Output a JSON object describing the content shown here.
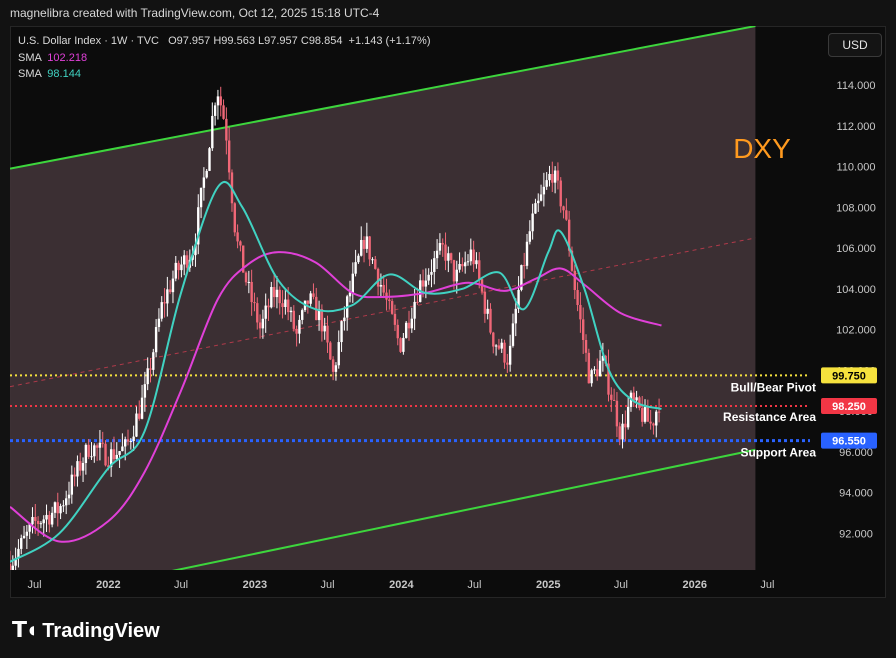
{
  "header": "magnelibra created with TradingView.com, Oct 12, 2025 15:18 UTC-4",
  "legend": {
    "symbol": "U.S. Dollar Index · 1W · TVC",
    "o_label": "O",
    "o": "97.957",
    "h_label": "H",
    "h": "99.563",
    "l_label": "L",
    "l": "97.957",
    "c_label": "C",
    "c": "98.854",
    "change": "+1.143 (+1.17%)",
    "sma1_label": "SMA",
    "sma1_value": "102.218",
    "sma2_label": "SMA",
    "sma2_value": "98.144"
  },
  "currency_button": "USD",
  "footer_brand": "TradingView",
  "colors": {
    "channel": "#3dd63d",
    "channel_fill": "#3e3236",
    "candle_up": "#ffffff",
    "candle_down": "#f06777",
    "sma_fast": "#40d2c2",
    "sma_slow": "#e040d8",
    "pivot": "#f6e23d",
    "resistance": "#f23645",
    "support": "#2962ff",
    "dxy_label": "#ff9a1f"
  },
  "chart_data": {
    "type": "candlestick",
    "title": "DXY",
    "y_axis": {
      "range": [
        90.2,
        116.9
      ],
      "ticks": [
        "92.000",
        "94.000",
        "96.000",
        "98.000",
        "100.000",
        "102.000",
        "104.000",
        "106.000",
        "108.000",
        "110.000",
        "112.000",
        "114.000"
      ]
    },
    "x_axis": {
      "range": [
        "2021-05-01",
        "2026-10-15"
      ],
      "ticks": [
        {
          "date": "2021-07-01",
          "label": "Jul"
        },
        {
          "date": "2022-01-01",
          "label": "2022"
        },
        {
          "date": "2022-07-01",
          "label": "Jul"
        },
        {
          "date": "2023-01-01",
          "label": "2023"
        },
        {
          "date": "2023-07-01",
          "label": "Jul"
        },
        {
          "date": "2024-01-01",
          "label": "2024"
        },
        {
          "date": "2024-07-01",
          "label": "Jul"
        },
        {
          "date": "2025-01-01",
          "label": "2025"
        },
        {
          "date": "2025-07-01",
          "label": "Jul"
        },
        {
          "date": "2026-01-01",
          "label": "2026"
        },
        {
          "date": "2026-07-01",
          "label": "Jul"
        }
      ]
    },
    "price_path": [
      {
        "date": "2021-05-01",
        "value": 90.5
      },
      {
        "date": "2021-07-01",
        "value": 92.5
      },
      {
        "date": "2021-09-01",
        "value": 93.2
      },
      {
        "date": "2021-11-15",
        "value": 96.3
      },
      {
        "date": "2022-01-01",
        "value": 95.8
      },
      {
        "date": "2022-02-15",
        "value": 96.2
      },
      {
        "date": "2022-04-01",
        "value": 98.8
      },
      {
        "date": "2022-05-15",
        "value": 103.2
      },
      {
        "date": "2022-06-15",
        "value": 104.7
      },
      {
        "date": "2022-08-01",
        "value": 106.0
      },
      {
        "date": "2022-09-01",
        "value": 110.0
      },
      {
        "date": "2022-09-28",
        "value": 114.0
      },
      {
        "date": "2022-10-20",
        "value": 112.0
      },
      {
        "date": "2022-11-15",
        "value": 106.5
      },
      {
        "date": "2022-12-15",
        "value": 104.0
      },
      {
        "date": "2023-01-15",
        "value": 102.0
      },
      {
        "date": "2023-02-15",
        "value": 103.8
      },
      {
        "date": "2023-03-15",
        "value": 103.5
      },
      {
        "date": "2023-04-15",
        "value": 101.7
      },
      {
        "date": "2023-05-15",
        "value": 103.5
      },
      {
        "date": "2023-06-15",
        "value": 102.5
      },
      {
        "date": "2023-07-15",
        "value": 99.8
      },
      {
        "date": "2023-08-15",
        "value": 103.0
      },
      {
        "date": "2023-10-01",
        "value": 106.5
      },
      {
        "date": "2023-11-15",
        "value": 104.0
      },
      {
        "date": "2023-12-28",
        "value": 101.2
      },
      {
        "date": "2024-02-15",
        "value": 104.2
      },
      {
        "date": "2024-04-15",
        "value": 106.0
      },
      {
        "date": "2024-05-15",
        "value": 104.5
      },
      {
        "date": "2024-06-25",
        "value": 105.8
      },
      {
        "date": "2024-07-15",
        "value": 104.2
      },
      {
        "date": "2024-08-15",
        "value": 101.6
      },
      {
        "date": "2024-09-25",
        "value": 100.5
      },
      {
        "date": "2024-10-20",
        "value": 104.0
      },
      {
        "date": "2024-11-20",
        "value": 107.2
      },
      {
        "date": "2025-01-10",
        "value": 109.8
      },
      {
        "date": "2025-02-10",
        "value": 107.8
      },
      {
        "date": "2025-03-10",
        "value": 103.8
      },
      {
        "date": "2025-04-15",
        "value": 99.5
      },
      {
        "date": "2025-05-15",
        "value": 100.5
      },
      {
        "date": "2025-06-15",
        "value": 98.2
      },
      {
        "date": "2025-07-01",
        "value": 96.8
      },
      {
        "date": "2025-07-25",
        "value": 98.5
      },
      {
        "date": "2025-08-15",
        "value": 98.0
      },
      {
        "date": "2025-09-15",
        "value": 97.3
      },
      {
        "date": "2025-10-10",
        "value": 98.85
      }
    ],
    "sma_slow": [
      {
        "date": "2021-05-01",
        "value": 93.3
      },
      {
        "date": "2021-09-01",
        "value": 91.6
      },
      {
        "date": "2022-01-01",
        "value": 92.6
      },
      {
        "date": "2022-04-01",
        "value": 95.0
      },
      {
        "date": "2022-07-01",
        "value": 99.0
      },
      {
        "date": "2022-10-01",
        "value": 103.5
      },
      {
        "date": "2022-12-15",
        "value": 105.2
      },
      {
        "date": "2023-03-01",
        "value": 105.8
      },
      {
        "date": "2023-06-01",
        "value": 105.3
      },
      {
        "date": "2023-09-01",
        "value": 103.8
      },
      {
        "date": "2023-11-15",
        "value": 103.6
      },
      {
        "date": "2024-03-01",
        "value": 103.8
      },
      {
        "date": "2024-06-15",
        "value": 104.3
      },
      {
        "date": "2024-09-15",
        "value": 103.9
      },
      {
        "date": "2024-12-01",
        "value": 104.5
      },
      {
        "date": "2025-02-01",
        "value": 105.0
      },
      {
        "date": "2025-04-01",
        "value": 104.2
      },
      {
        "date": "2025-07-01",
        "value": 102.8
      },
      {
        "date": "2025-10-10",
        "value": 102.2
      }
    ],
    "sma_fast": [
      {
        "date": "2021-05-01",
        "value": 90.6
      },
      {
        "date": "2021-09-01",
        "value": 92.0
      },
      {
        "date": "2022-01-01",
        "value": 95.2
      },
      {
        "date": "2022-04-01",
        "value": 97.0
      },
      {
        "date": "2022-07-01",
        "value": 103.8
      },
      {
        "date": "2022-10-01",
        "value": 109.0
      },
      {
        "date": "2022-12-01",
        "value": 108.0
      },
      {
        "date": "2023-03-01",
        "value": 104.4
      },
      {
        "date": "2023-06-01",
        "value": 103.0
      },
      {
        "date": "2023-09-01",
        "value": 103.2
      },
      {
        "date": "2023-12-01",
        "value": 104.7
      },
      {
        "date": "2024-03-01",
        "value": 103.8
      },
      {
        "date": "2024-06-01",
        "value": 104.0
      },
      {
        "date": "2024-09-01",
        "value": 104.8
      },
      {
        "date": "2024-11-01",
        "value": 103.0
      },
      {
        "date": "2025-01-01",
        "value": 105.8
      },
      {
        "date": "2025-02-01",
        "value": 106.8
      },
      {
        "date": "2025-04-01",
        "value": 104.0
      },
      {
        "date": "2025-06-01",
        "value": 100.0
      },
      {
        "date": "2025-08-01",
        "value": 98.5
      },
      {
        "date": "2025-10-10",
        "value": 98.1
      }
    ],
    "channel": {
      "upper": [
        {
          "date": "2021-05-01",
          "value": 109.9
        },
        {
          "date": "2026-06-01",
          "value": 116.9
        }
      ],
      "lower": [
        {
          "date": "2021-05-01",
          "value": 88.5
        },
        {
          "date": "2026-06-01",
          "value": 96.1
        }
      ],
      "mid": [
        {
          "date": "2021-05-01",
          "value": 99.2
        },
        {
          "date": "2026-06-01",
          "value": 106.5
        }
      ]
    },
    "levels": [
      {
        "name": "Bull/Bear Pivot",
        "value": 99.75,
        "label": "99.750",
        "style": "dotted"
      },
      {
        "name": "Resistance Area",
        "value": 98.25,
        "label": "98.250",
        "style": "dotted"
      },
      {
        "name": "Support Area",
        "value": 96.55,
        "label": "96.550",
        "style": "dotted"
      }
    ],
    "annotations": [
      "DXY",
      "Bull/Bear Pivot",
      "Resistance Area",
      "Support Area"
    ],
    "grid": false,
    "legend_position": "top-left"
  }
}
